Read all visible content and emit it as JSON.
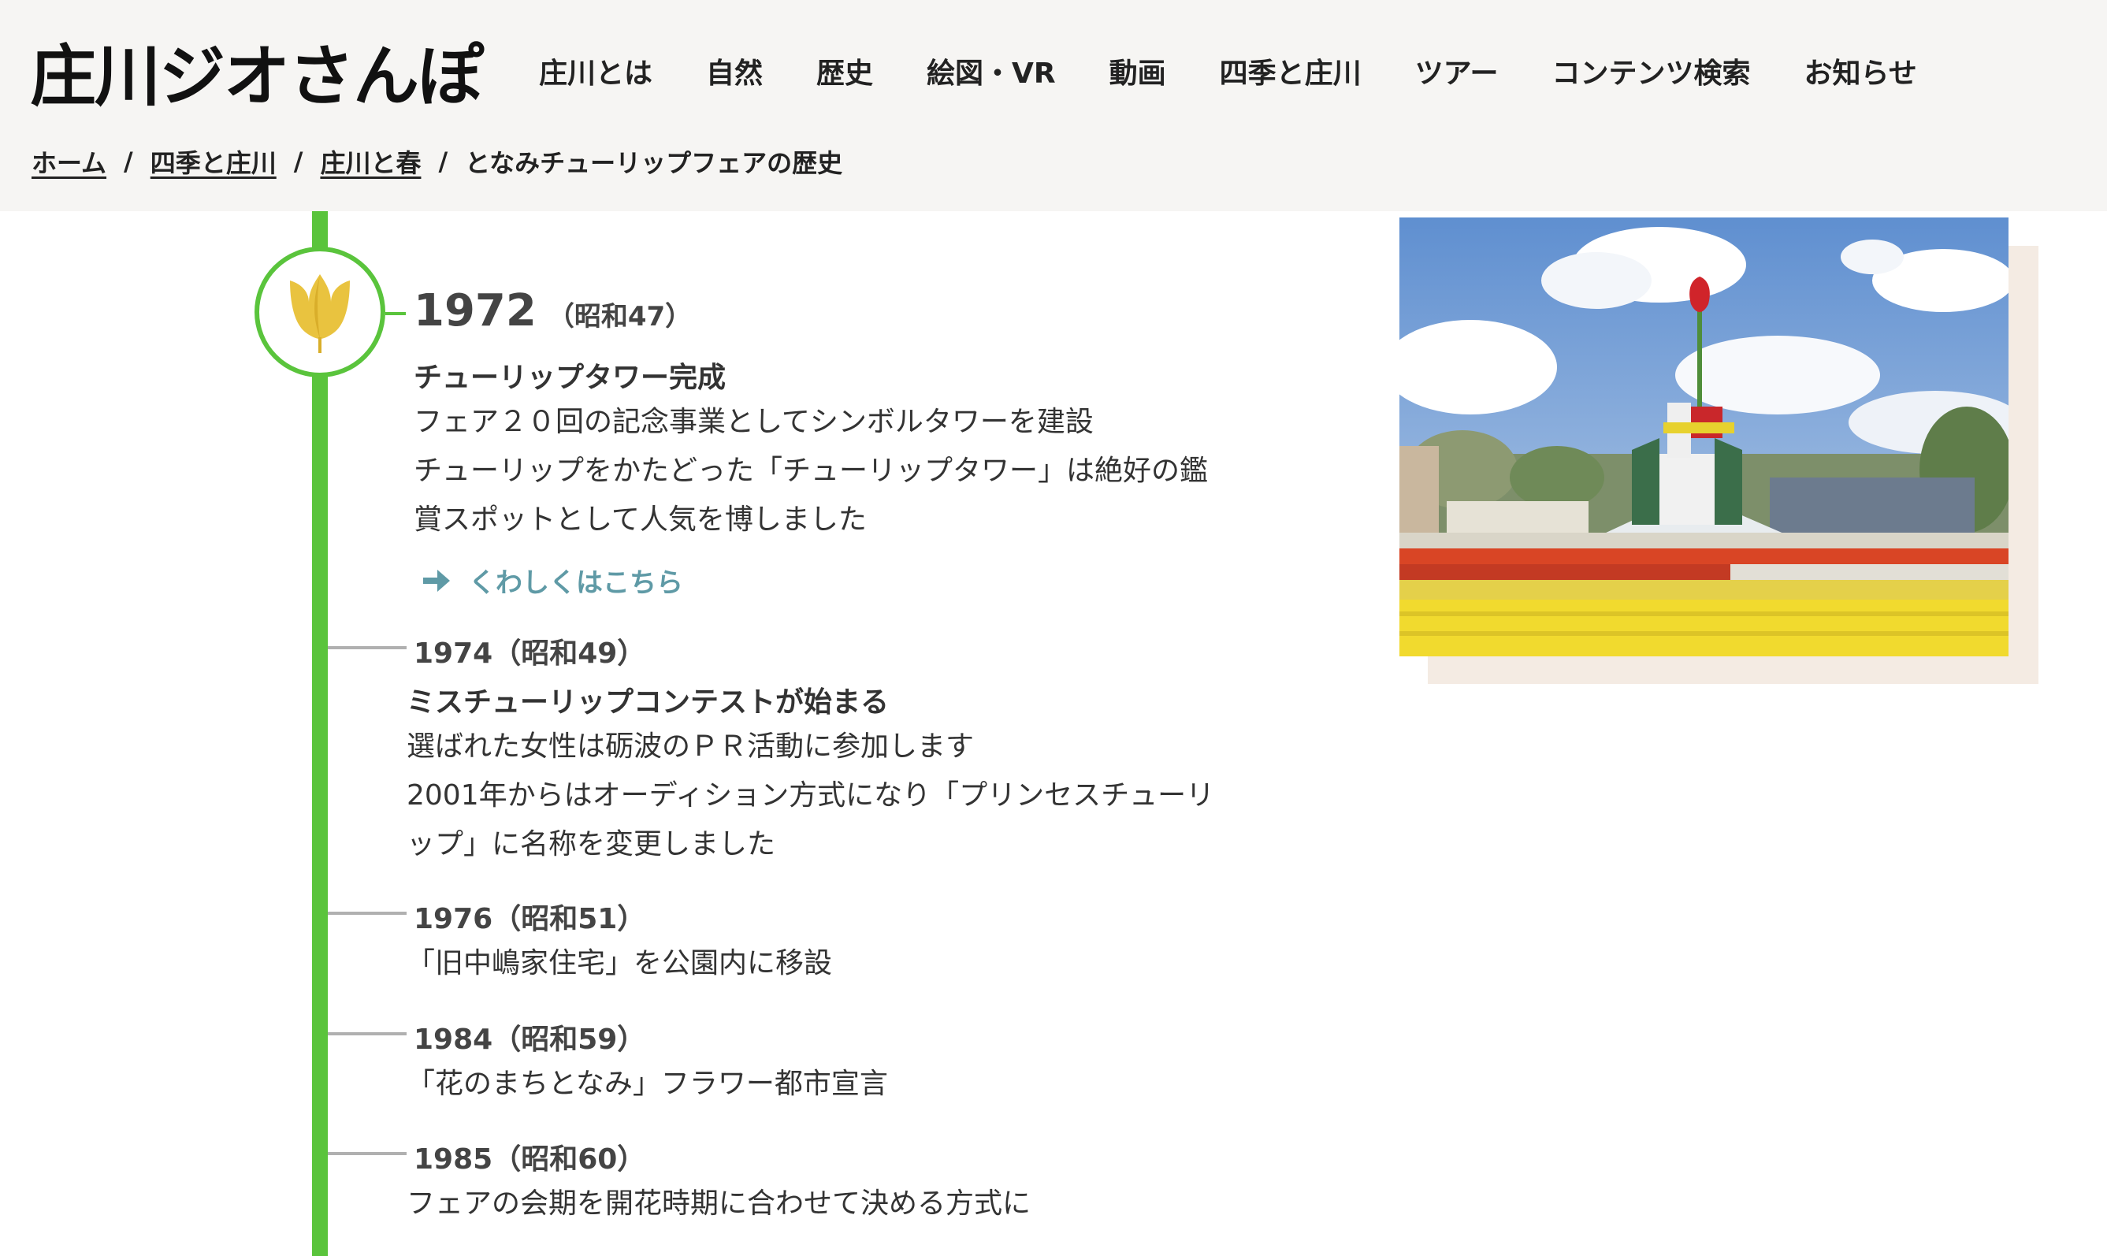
{
  "site": {
    "logo_text": "庄川ジオさんぽ"
  },
  "nav": {
    "items": [
      {
        "label": "庄川とは"
      },
      {
        "label": "自然"
      },
      {
        "label": "歴史"
      },
      {
        "label": "絵図・VR"
      },
      {
        "label": "動画"
      },
      {
        "label": "四季と庄川"
      },
      {
        "label": "ツアー"
      },
      {
        "label": "コンテンツ検索"
      },
      {
        "label": "お知らせ"
      }
    ]
  },
  "breadcrumb": {
    "items": [
      {
        "label": "ホーム"
      },
      {
        "label": "四季と庄川"
      },
      {
        "label": "庄川と春"
      }
    ],
    "separator": "/",
    "current": "となみチューリップフェアの歴史"
  },
  "timeline": {
    "featured": {
      "year": "1972",
      "era": "（昭和47）",
      "title": "チューリップタワー完成",
      "lines": [
        "フェア２０回の記念事業としてシンボルタワーを建設",
        "チューリップをかたどった「チューリップタワー」は絶好の鑑",
        "賞スポットとして人気を博しました"
      ],
      "link_label": "くわしくはこちら"
    },
    "entries": [
      {
        "year_label": "1974（昭和49）",
        "title": "ミスチューリップコンテストが始まる",
        "lines": [
          "選ばれた女性は砺波のＰＲ活動に参加します",
          "2001年からはオーディション方式になり「プリンセスチューリ",
          "ップ」に名称を変更しました"
        ]
      },
      {
        "year_label": "1976（昭和51）",
        "lines": [
          "「旧中嶋家住宅」を公園内に移設"
        ]
      },
      {
        "year_label": "1984（昭和59）",
        "lines": [
          "「花のまちとなみ」フラワー都市宣言"
        ]
      },
      {
        "year_label": "1985（昭和60）",
        "lines": [
          "フェアの会期を開花時期に合わせて決める方式に"
        ]
      }
    ]
  },
  "colors": {
    "timeline_green": "#5ac43c",
    "tulip_yellow": "#e9c33f",
    "link_teal": "#5f9aa6",
    "header_bg": "#f6f5f3"
  }
}
